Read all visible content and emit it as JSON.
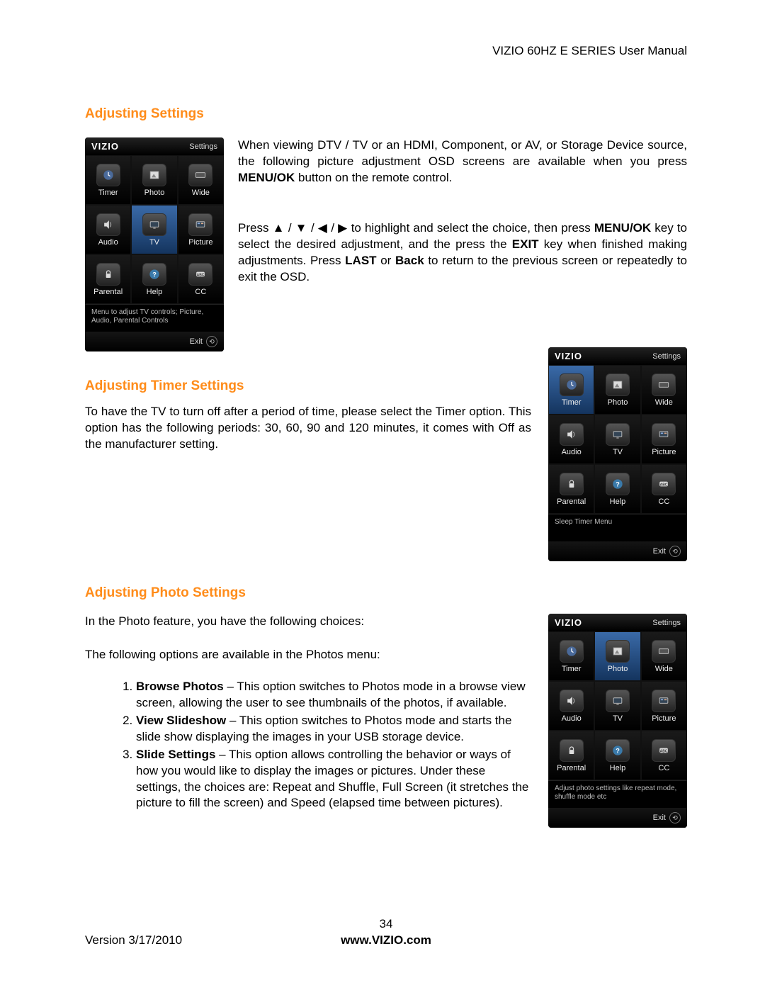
{
  "header": {
    "docTitle": "VIZIO 60HZ E SERIES User Manual"
  },
  "sections": {
    "adjusting": {
      "title": "Adjusting Settings"
    },
    "timer": {
      "title": "Adjusting Timer Settings"
    },
    "photo": {
      "title": "Adjusting Photo Settings"
    }
  },
  "paragraphs": {
    "intro1a": "When viewing DTV / TV or an HDMI, Component, or AV, or Storage Device source, the following picture adjustment OSD screens are available when you press ",
    "intro1_bold1": "MENU/OK",
    "intro1b": " button on the remote control.",
    "intro2a": "Press ",
    "intro2_arrows": "▲ / ▼ / ◀ / ▶",
    "intro2b": " to highlight and select the choice, then press ",
    "intro2_bold1": "MENU/OK",
    "intro2c": " key to select the desired adjustment, and the press the ",
    "intro2_bold2": "EXIT",
    "intro2d": " key when finished making adjustments. Press ",
    "intro2_bold3": "LAST",
    "intro2e": " or ",
    "intro2_bold4": "Back",
    "intro2f": " to return to the previous screen or repeatedly to exit the OSD.",
    "timer1": "To have the TV to turn off after a period of time, please select the Timer option. This option has the following periods: 30, 60, 90 and 120 minutes, it comes with Off as the manufacturer setting.",
    "photo1": "In the Photo feature, you have the following choices:",
    "photo2": "The following options are available in the Photos menu:"
  },
  "photoList": {
    "item1_bold": "Browse Photos",
    "item1_rest": " – This option switches to Photos mode in a browse view screen, allowing the user to see thumbnails of the photos, if available.",
    "item2_bold": "View Slideshow",
    "item2_rest": " – This option switches to Photos mode and starts the slide show displaying the images in your USB storage device.",
    "item3_bold": "Slide Settings",
    "item3_rest": " – This option allows controlling the behavior or ways of how you would like to display the images or pictures. Under these settings, the choices are: Repeat and Shuffle,  Full Screen (it stretches the picture to fill the screen) and Speed (elapsed time between pictures)."
  },
  "osd": {
    "logo": "VIZIO",
    "headerLabel": "Settings",
    "exit": "Exit",
    "cells": {
      "timer": "Timer",
      "photo": "Photo",
      "wide": "Wide",
      "audio": "Audio",
      "tv": "TV",
      "picture": "Picture",
      "parental": "Parental",
      "help": "Help",
      "cc": "CC"
    },
    "help1": "Menu to adjust TV controls; Picture, Audio, Parental Controls",
    "help2": "Sleep Timer Menu",
    "help3": "Adjust photo settings like repeat mode, shuffle mode etc"
  },
  "footer": {
    "pageNum": "34",
    "version": "Version 3/17/2010",
    "url": "www.VIZIO.com"
  }
}
